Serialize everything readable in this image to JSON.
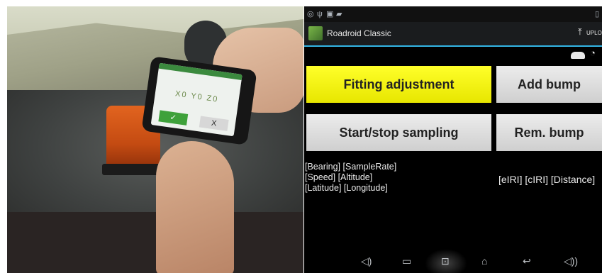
{
  "app": {
    "title": "Roadroid Classic",
    "upload_label": "UPLO"
  },
  "buttons": {
    "fitting_adjustment": "Fitting adjustment",
    "add_bump": "Add bump",
    "start_stop_sampling": "Start/stop sampling",
    "rem_bump": "Rem. bump"
  },
  "info": {
    "line1": "[Bearing] [SampleRate]",
    "line2": "[Speed] [Altitude]",
    "line3": "[Latitude] [Longitude]",
    "right": "[eIRI] [cIRI] [Distance]"
  },
  "photo_phone": {
    "xyz": "X0 Y0 Z0",
    "ok": "✓",
    "cancel": "X"
  },
  "colors": {
    "accent_blue": "#33b5e5",
    "fitting_yellow": "#ffff2a",
    "button_gray": "#dcdcdc"
  },
  "icons": {
    "status": [
      "location-icon",
      "usb-icon",
      "image-icon",
      "notification-icon"
    ],
    "nav": [
      "volume-down-icon",
      "recent-apps-icon",
      "screenshot-icon",
      "home-icon",
      "back-icon",
      "volume-up-icon"
    ]
  }
}
